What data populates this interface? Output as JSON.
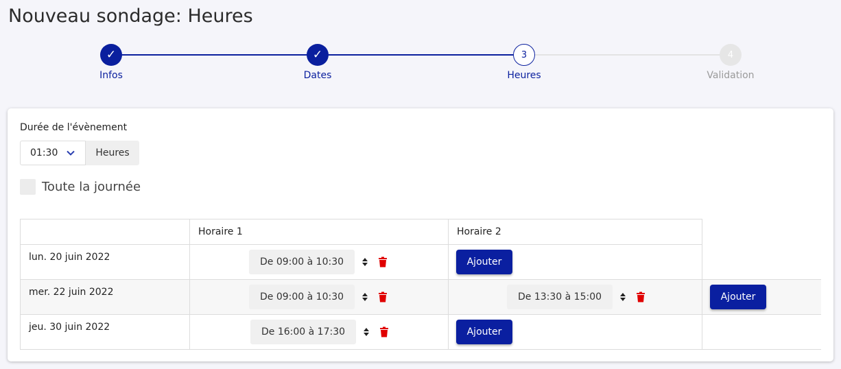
{
  "title": "Nouveau sondage: Heures",
  "stepper": {
    "steps": [
      {
        "label": "Infos",
        "marker": "✓",
        "state": "done"
      },
      {
        "label": "Dates",
        "marker": "✓",
        "state": "done"
      },
      {
        "label": "Heures",
        "marker": "3",
        "state": "current"
      },
      {
        "label": "Validation",
        "marker": "4",
        "state": "todo"
      }
    ]
  },
  "duration": {
    "label": "Durée de l'évènement",
    "value": "01:30",
    "unit": "Heures"
  },
  "allday": {
    "label": "Toute la journée",
    "checked": false
  },
  "table": {
    "headers": [
      "",
      "Horaire 1",
      "Horaire 2"
    ],
    "rows": [
      {
        "date": "lun. 20 juin 2022",
        "slots": [
          "De 09:00 à 10:30"
        ],
        "add_label": "Ajouter"
      },
      {
        "date": "mer. 22 juin 2022",
        "slots": [
          "De 09:00 à 10:30",
          "De 13:30 à 15:00"
        ],
        "add_label": "Ajouter"
      },
      {
        "date": "jeu. 30 juin 2022",
        "slots": [
          "De 16:00 à 17:30"
        ],
        "add_label": "Ajouter"
      }
    ]
  },
  "colors": {
    "primary": "#0a1f9e",
    "delete": "#e00000",
    "stripe": "#f7f7f7"
  }
}
